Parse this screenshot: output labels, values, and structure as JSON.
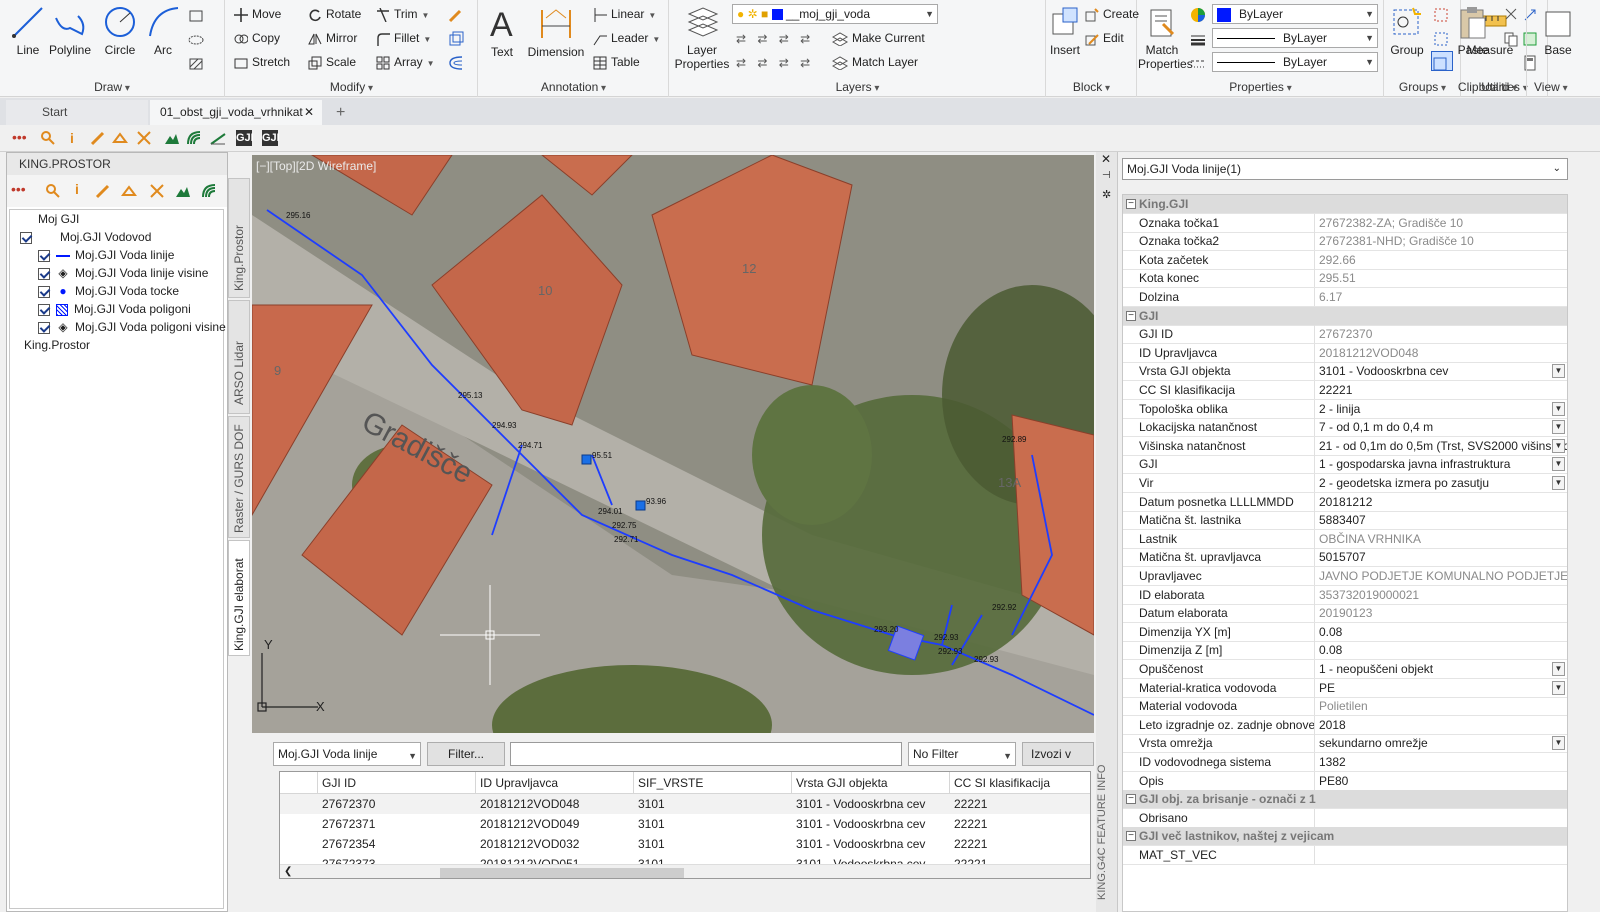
{
  "ribbon": {
    "draw": {
      "title": "Draw",
      "line": "Line",
      "polyline": "Polyline",
      "circle": "Circle",
      "arc": "Arc"
    },
    "modify": {
      "title": "Modify",
      "move": "Move",
      "rotate": "Rotate",
      "trim": "Trim",
      "copy": "Copy",
      "mirror": "Mirror",
      "fillet": "Fillet",
      "stretch": "Stretch",
      "scale": "Scale",
      "array": "Array"
    },
    "annotation": {
      "title": "Annotation",
      "text": "Text",
      "dimension": "Dimension",
      "linear": "Linear",
      "leader": "Leader",
      "table": "Table"
    },
    "layers": {
      "title": "Layers",
      "layer_properties": "Layer Properties",
      "layer_combo": "__moj_gji_voda",
      "make_current": "Make Current",
      "match_layer": "Match Layer"
    },
    "block": {
      "title": "Block",
      "insert": "Insert",
      "create": "Create",
      "edit": "Edit"
    },
    "properties": {
      "title": "Properties",
      "match_properties": "Match Properties",
      "color": "ByLayer",
      "linetype": "ByLayer",
      "lineweight": "ByLayer"
    },
    "groups": {
      "title": "Groups",
      "group": "Group"
    },
    "utilities": {
      "title": "Utilities",
      "measure": "Measure"
    },
    "clipboard": {
      "title": "Clipboard",
      "paste": "Paste"
    },
    "view": {
      "title": "View",
      "base": "Base"
    }
  },
  "tabs": {
    "start": "Start",
    "doc": "01_obst_gji_voda_vrhnikat"
  },
  "left": {
    "title": "KING.PROSTOR",
    "tree": [
      "Moj GJI",
      "Moj.GJI Vodovod",
      "Moj.GJI Voda linije",
      "Moj.GJI Voda linije visine",
      "Moj.GJI Voda tocke",
      "Moj.GJI Voda poligoni",
      "Moj.GJI Voda poligoni visine",
      "King.Prostor"
    ],
    "vtabs": [
      "King.Prostor",
      "ARSO Lidar",
      "Raster / GURS DOF",
      "King.GJI elaborat"
    ]
  },
  "viewport": {
    "label": "[−][Top][2D Wireframe]",
    "street": "Gradišče",
    "house_nums": [
      "10",
      "12",
      "9",
      "13A"
    ],
    "elevations": [
      "295.16",
      "295.13",
      "294.93",
      "294.71",
      "95.51",
      "93.96",
      "294.01",
      "292.75",
      "292.71",
      "292.89",
      "292.92",
      "293.20",
      "292.93",
      "292.93",
      "292.93"
    ]
  },
  "grid": {
    "layer": "Moj.GJI Voda linije",
    "filter_btn": "Filter...",
    "nofilter": "No Filter",
    "export": "Izvozi v",
    "cols": [
      "GJI ID",
      "ID Upravljavca",
      "SIF_VRSTE",
      "Vrsta GJI objekta",
      "CC SI klasifikacija"
    ],
    "rows": [
      [
        "27672370",
        "20181212VOD048",
        "3101",
        "3101 - Vodooskrbna cev",
        "22221"
      ],
      [
        "27672371",
        "20181212VOD049",
        "3101",
        "3101 - Vodooskrbna cev",
        "22221"
      ],
      [
        "27672354",
        "20181212VOD032",
        "3101",
        "3101 - Vodooskrbna cev",
        "22221"
      ],
      [
        "27672373",
        "20181212VOD051",
        "3101",
        "3101 - Vodooskrbna cev",
        "22221"
      ]
    ]
  },
  "props": {
    "selector": "Moj.GJI Voda linije(1)",
    "side_title": "KING.G4C FEATURE INFO",
    "rows": [
      {
        "cat": "King.GJI"
      },
      {
        "k": "Oznaka točka1",
        "v": "27672382-ZA; Gradišče 10",
        "ro": true
      },
      {
        "k": "Oznaka točka2",
        "v": "27672381-NHD; Gradišče 10",
        "ro": true
      },
      {
        "k": "Kota začetek",
        "v": "292.66",
        "ro": true
      },
      {
        "k": "Kota konec",
        "v": "295.51",
        "ro": true
      },
      {
        "k": "Dolzina",
        "v": "6.17",
        "ro": true
      },
      {
        "cat": "GJI"
      },
      {
        "k": "GJI ID",
        "v": "27672370",
        "ro": true
      },
      {
        "k": "ID Upravljavca",
        "v": "20181212VOD048",
        "ro": true
      },
      {
        "k": "Vrsta GJI objekta",
        "v": "3101 - Vodooskrbna cev",
        "dd": true
      },
      {
        "k": "CC SI klasifikacija",
        "v": "22221"
      },
      {
        "k": "Topološka oblika",
        "v": "2 - linija",
        "dd": true
      },
      {
        "k": "Lokacijska natančnost",
        "v": "7 - od 0,1 m do 0,4 m",
        "dd": true
      },
      {
        "k": "Višinska natančnost",
        "v": "21 - od 0,1m do 0,5m (Trst, SVS2000  višinski d",
        "dd": true
      },
      {
        "k": "GJI",
        "v": "1 - gospodarska javna infrastruktura",
        "dd": true
      },
      {
        "k": "Vir",
        "v": "2 - geodetska izmera po zasutju",
        "dd": true
      },
      {
        "k": "Datum posnetka LLLLMMDD",
        "v": "20181212"
      },
      {
        "k": "Matična št. lastnika",
        "v": "5883407"
      },
      {
        "k": "Lastnik",
        "v": "OBČINA VRHNIKA",
        "ro": true
      },
      {
        "k": "Matična št. upravljavca",
        "v": "5015707"
      },
      {
        "k": "Upravljavec",
        "v": "JAVNO PODJETJE KOMUNALNO PODJETJE VRHNI",
        "ro": true
      },
      {
        "k": "ID elaborata",
        "v": "353732019000021",
        "ro": true
      },
      {
        "k": "Datum elaborata",
        "v": "20190123",
        "ro": true
      },
      {
        "k": "Dimenzija YX [m]",
        "v": "0.08"
      },
      {
        "k": "Dimenzija Z [m]",
        "v": "0.08"
      },
      {
        "k": "Opuščenost",
        "v": "1 - neopuščeni objekt",
        "dd": true
      },
      {
        "k": "Material-kratica vodovoda",
        "v": "PE",
        "dd": true
      },
      {
        "k": "Material vodovoda",
        "v": "Polietilen",
        "ro": true
      },
      {
        "k": "Leto izgradnje oz. zadnje obnove",
        "v": "2018"
      },
      {
        "k": "Vrsta omrežja",
        "v": "sekundarno omrežje",
        "dd": true
      },
      {
        "k": "ID vodovodnega sistema",
        "v": "1382"
      },
      {
        "k": "Opis",
        "v": "PE80"
      },
      {
        "cat": "GJI obj. za brisanje - označi z 1"
      },
      {
        "k": "Obrisano",
        "v": ""
      },
      {
        "cat": "GJI več lastnikov, naštej z vejicam"
      },
      {
        "k": "MAT_ST_VEC",
        "v": ""
      }
    ]
  },
  "colors": {
    "accent": "#0a5bd6",
    "pipe": "#1e3dff",
    "roof": "#c4674a"
  }
}
